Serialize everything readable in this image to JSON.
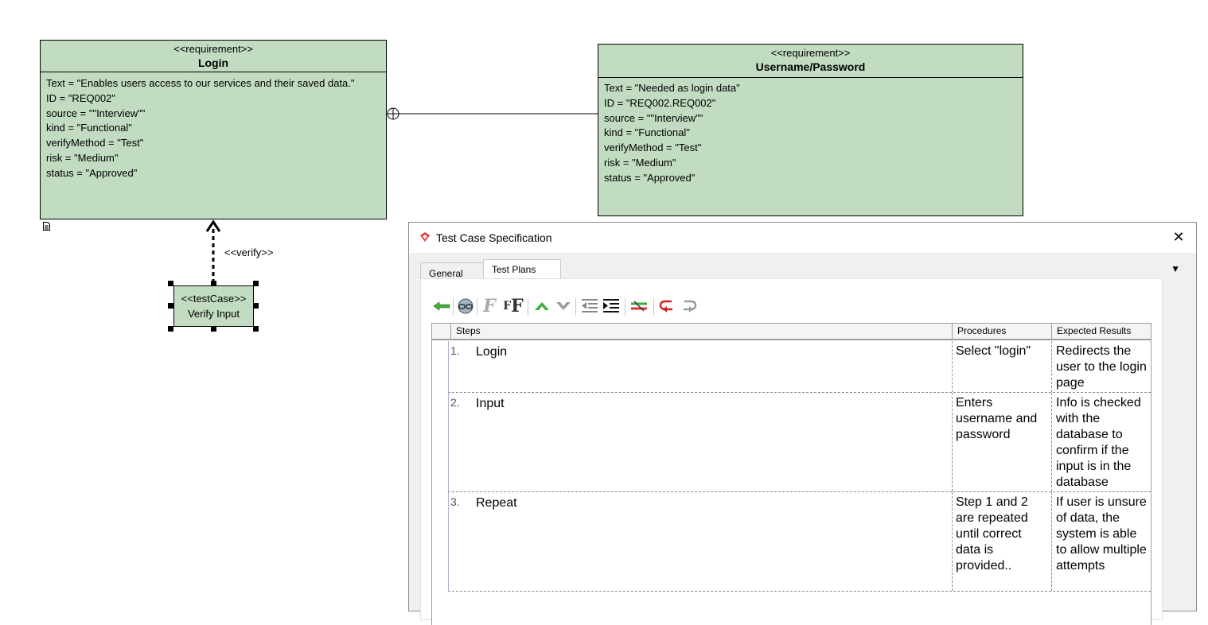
{
  "diagram": {
    "requirements": [
      {
        "stereotype": "<<requirement>>",
        "name": "Login",
        "attributes": [
          "Text = \"Enables users access to our services and their saved data.\"",
          "ID = \"REQ002\"",
          "source = \"\"Interview\"\"",
          "kind = \"Functional\"",
          "verifyMethod = \"Test\"",
          "risk = \"Medium\"",
          "status = \"Approved\""
        ]
      },
      {
        "stereotype": "<<requirement>>",
        "name": "Username/Password",
        "attributes": [
          "Text = \"Needed as login data\"",
          "ID = \"REQ002.REQ002\"",
          "source = \"\"Interview\"\"",
          "kind = \"Functional\"",
          "verifyMethod = \"Test\"",
          "risk = \"Medium\"",
          "status = \"Approved\""
        ]
      }
    ],
    "test_case": {
      "stereotype": "<<testCase>>",
      "name": "Verify Input"
    },
    "verify_label": "<<verify>>"
  },
  "dialog": {
    "title": "Test Case Specification",
    "close_icon": "close-icon",
    "tabs": [
      {
        "label": "General",
        "active": false
      },
      {
        "label": "Test Plans",
        "active": true
      }
    ],
    "toolbar_icons": [
      "back-arrow-icon",
      "link-icon",
      "italic-format-icon",
      "bold-format-icon",
      "move-up-icon",
      "move-down-icon",
      "outdent-icon",
      "indent-icon",
      "remove-icon",
      "undo-icon",
      "redo-icon"
    ],
    "table": {
      "headers": [
        "Steps",
        "Procedures",
        "Expected Results"
      ],
      "rows": [
        {
          "num": "1.",
          "step": "Login",
          "procedure": "Select \"login\"",
          "expected": "Redirects the user to the login page"
        },
        {
          "num": "2.",
          "step": "Input",
          "procedure": "Enters username and password",
          "expected": "Info is checked with the database to confirm if the input is in the database"
        },
        {
          "num": "3.",
          "step": "Repeat",
          "procedure": "Step 1 and 2 are repeated until correct data is provided..",
          "expected": "If user is unsure of data, the system is able to allow multiple attempts"
        }
      ]
    }
  }
}
